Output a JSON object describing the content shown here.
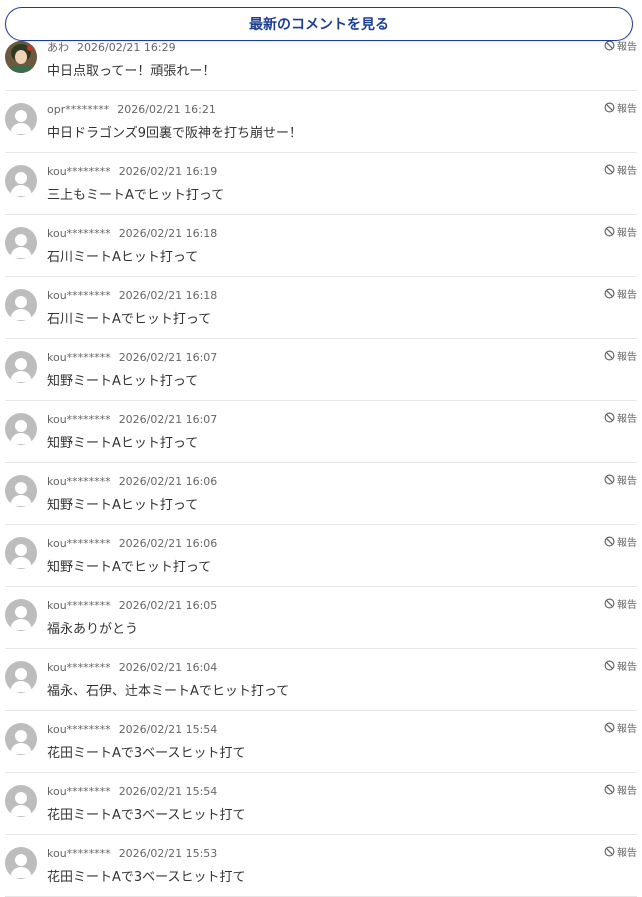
{
  "latest_button": {
    "label": "最新のコメントを見る"
  },
  "report_label": "報告",
  "comments": [
    {
      "user": "あわ",
      "time": "2026/02/21 16:29",
      "text": "中日点取ってー！頑張れー！",
      "avatar": "custom"
    },
    {
      "user": "opr********",
      "time": "2026/02/21 16:21",
      "text": "中日ドラゴンズ9回裏で阪神を打ち崩せー！",
      "avatar": "default"
    },
    {
      "user": "kou********",
      "time": "2026/02/21 16:19",
      "text": "三上もミートAでヒット打って",
      "avatar": "default"
    },
    {
      "user": "kou********",
      "time": "2026/02/21 16:18",
      "text": "石川ミートAヒット打って",
      "avatar": "default"
    },
    {
      "user": "kou********",
      "time": "2026/02/21 16:18",
      "text": "石川ミートAでヒット打って",
      "avatar": "default"
    },
    {
      "user": "kou********",
      "time": "2026/02/21 16:07",
      "text": "知野ミートAヒット打って",
      "avatar": "default"
    },
    {
      "user": "kou********",
      "time": "2026/02/21 16:07",
      "text": "知野ミートAヒット打って",
      "avatar": "default"
    },
    {
      "user": "kou********",
      "time": "2026/02/21 16:06",
      "text": "知野ミートAヒット打って",
      "avatar": "default"
    },
    {
      "user": "kou********",
      "time": "2026/02/21 16:06",
      "text": "知野ミートAでヒット打って",
      "avatar": "default"
    },
    {
      "user": "kou********",
      "time": "2026/02/21 16:05",
      "text": "福永ありがとう",
      "avatar": "default"
    },
    {
      "user": "kou********",
      "time": "2026/02/21 16:04",
      "text": "福永、石伊、辻本ミートAでヒット打って",
      "avatar": "default"
    },
    {
      "user": "kou********",
      "time": "2026/02/21 15:54",
      "text": "花田ミートAで3ベースヒット打て",
      "avatar": "default"
    },
    {
      "user": "kou********",
      "time": "2026/02/21 15:54",
      "text": "花田ミートAで3ベースヒット打て",
      "avatar": "default"
    },
    {
      "user": "kou********",
      "time": "2026/02/21 15:53",
      "text": "花田ミートAで3ベースヒット打て",
      "avatar": "default"
    }
  ],
  "colors": {
    "accent": "#1d3f93",
    "avatar_default": "#bdbdbd",
    "divider": "#e6e6e6",
    "meta_text": "#666666",
    "body_text": "#333333"
  }
}
